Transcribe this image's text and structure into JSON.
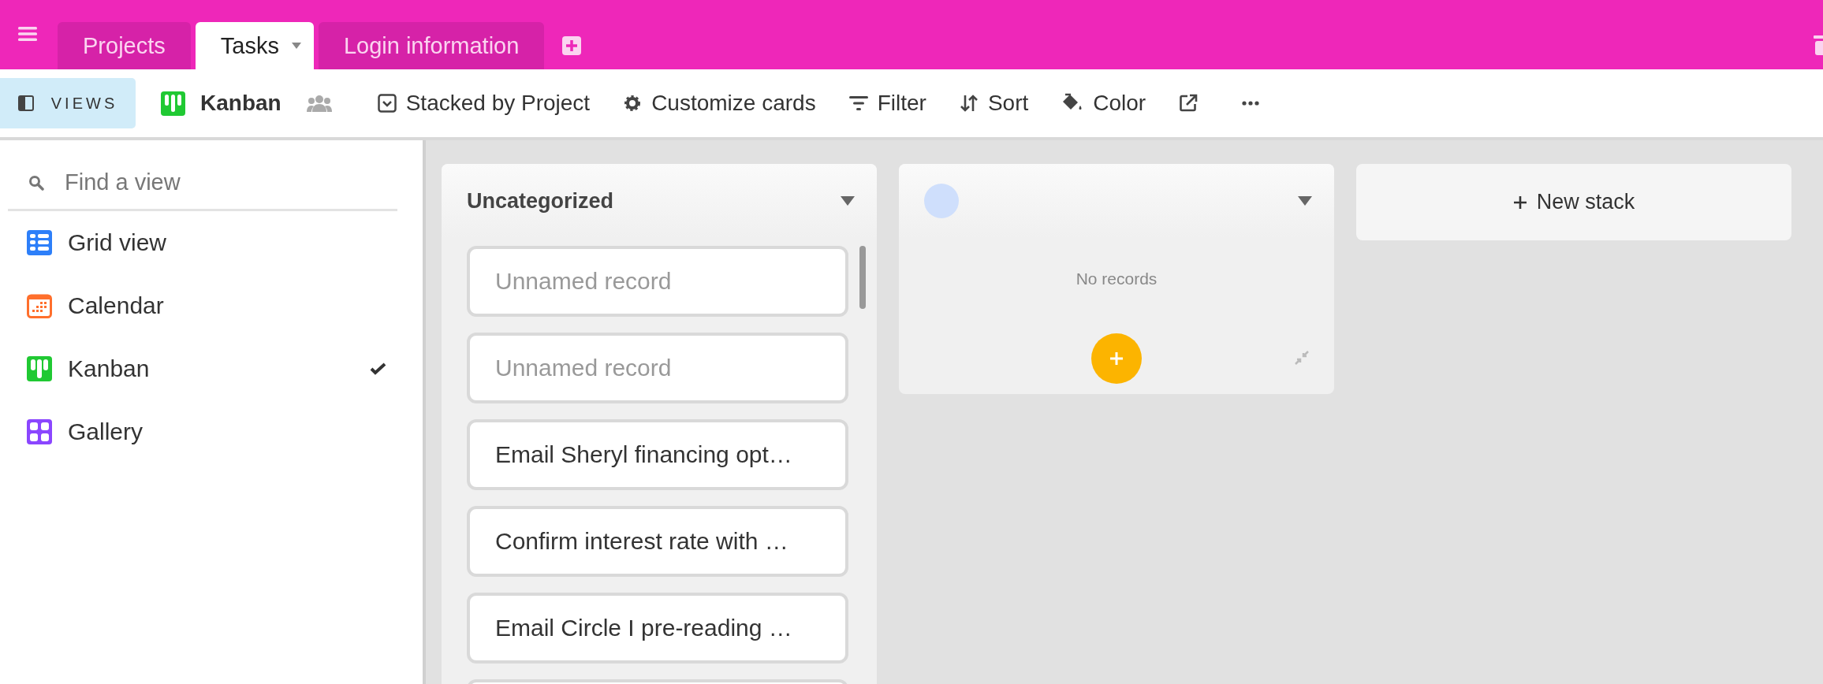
{
  "tabs": [
    {
      "label": "Projects",
      "selected": false
    },
    {
      "label": "Tasks",
      "selected": true
    },
    {
      "label": "Login information",
      "selected": false
    }
  ],
  "toolbar": {
    "views_button": "VIEWS",
    "view_name": "Kanban",
    "items": [
      {
        "kind": "stacked",
        "label": "Stacked by Project"
      },
      {
        "kind": "customize",
        "label": "Customize cards"
      },
      {
        "kind": "filter",
        "label": "Filter"
      },
      {
        "kind": "sort",
        "label": "Sort"
      },
      {
        "kind": "color",
        "label": "Color"
      },
      {
        "kind": "share"
      },
      {
        "kind": "more"
      }
    ]
  },
  "sidebar": {
    "search": {
      "placeholder": "Find a view"
    },
    "items": [
      {
        "kind": "grid",
        "label": "Grid view",
        "selected": false
      },
      {
        "kind": "calendar",
        "label": "Calendar",
        "selected": false
      },
      {
        "kind": "kanban",
        "label": "Kanban",
        "selected": true
      },
      {
        "kind": "gallery",
        "label": "Gallery",
        "selected": false
      }
    ]
  },
  "board": {
    "stacks": [
      {
        "title": "Uncategorized",
        "cards": [
          {
            "title": "Unnamed record",
            "unnamed": true
          },
          {
            "title": "Unnamed record",
            "unnamed": true
          },
          {
            "title": "Email Sheryl financing opt…",
            "unnamed": false
          },
          {
            "title": "Confirm interest rate with …",
            "unnamed": false
          },
          {
            "title": "Email Circle I pre-reading …",
            "unnamed": false
          }
        ]
      },
      {
        "color": "#cfdffc",
        "empty_text": "No records"
      }
    ],
    "new_stack": "New stack"
  }
}
